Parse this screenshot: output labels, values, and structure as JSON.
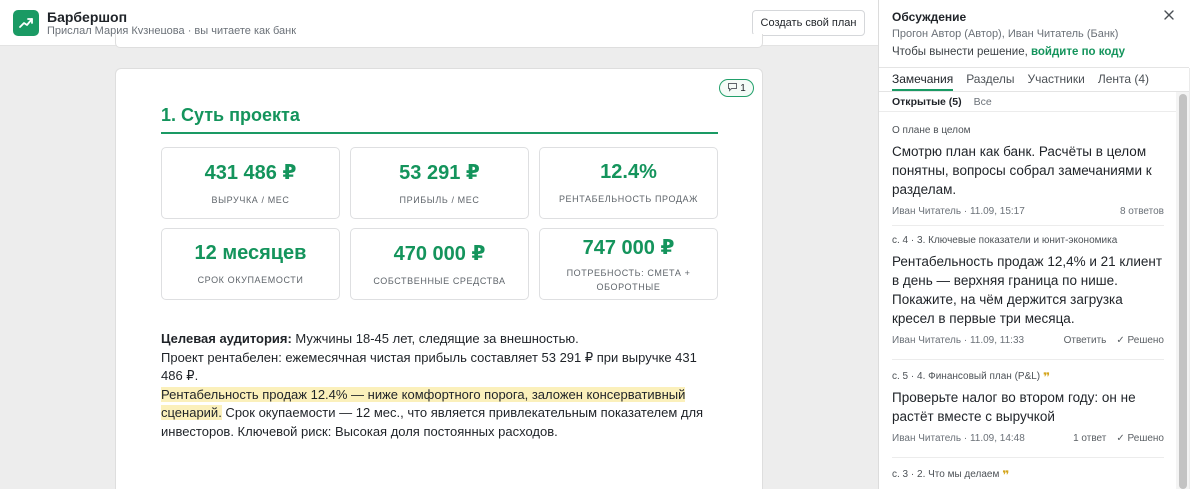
{
  "header": {
    "title": "Барбершоп",
    "subtitle": "Прислал Мария Кузнецова · вы читаете как банк",
    "create_button": "Создать свой план"
  },
  "document": {
    "comment_count": "1",
    "section_title": "1. Суть проекта",
    "metrics": [
      {
        "value": "431 486 ₽",
        "label": "ВЫРУЧКА / МЕС"
      },
      {
        "value": "53 291 ₽",
        "label": "ПРИБЫЛЬ / МЕС"
      },
      {
        "value": "12.4%",
        "label": "РЕНТАБЕЛЬНОСТЬ ПРОДАЖ"
      },
      {
        "value": "12 месяцев",
        "label": "СРОК ОКУПАЕМОСТИ"
      },
      {
        "value": "470 000 ₽",
        "label": "СОБСТВЕННЫЕ СРЕДСТВА"
      },
      {
        "value": "747 000 ₽",
        "label": "ПОТРЕБНОСТЬ: СМЕТА + ОБОРОТНЫЕ"
      }
    ],
    "audience_label": "Целевая аудитория:",
    "audience_text": " Мужчины 18-45 лет, следящие за внешностью.",
    "profit_text": "Проект рентабелен: ежемесячная чистая прибыль составляет 53 291 ₽ при выручке 431 486 ₽.",
    "highlight_text": "Рентабельность продаж 12.4% — ниже комфортного порога, заложен консервативный сценарий.",
    "rest_text": " Срок окупаемости — 12 мес., что является привлекательным показателем для инвесторов. Ключевой риск: Высокая доля постоянных расходов."
  },
  "discussion": {
    "title": "Обсуждение",
    "participants": "Прогон Автор (Автор), Иван Читатель (Банк)",
    "resolve_prefix": "Чтобы вынести решение, ",
    "resolve_link": "войдите по коду",
    "tabs": [
      "Замечания",
      "Разделы",
      "Участники",
      "Лента (4)"
    ],
    "filters": [
      "Открытые (5)",
      "Все"
    ],
    "comments": [
      {
        "location": "О плане в целом",
        "text": "Смотрю план как банк. Расчёты в целом понятны, вопросы собрал замечаниями к разделам.",
        "meta": "Иван Читатель · 11.09, 15:17",
        "replies": "8 ответов"
      },
      {
        "location": "с. 4 · 3. Ключевые показатели и юнит-экономика",
        "text": "Рентабельность продаж 12,4% и 21 клиент в день — верхняя граница по нише. Покажите, на чём держится загрузка кресел в первые три месяца.",
        "meta": "Иван Читатель · 11.09, 11:33",
        "reply_action": "Ответить",
        "resolve_action": "Решено"
      },
      {
        "location": "с. 5 · 4. Финансовый план (P&L)",
        "text": "Проверьте налог во втором году: он не растёт вместе с выручкой",
        "meta": "Иван Читатель · 11.09, 14:48",
        "replies": "1 ответ",
        "resolve_action": "Решено"
      },
      {
        "location": "с. 3 · 2. Что мы делаем"
      }
    ]
  },
  "colors": {
    "accent": "#1a9a64",
    "highlight": "#fbf0bb",
    "quote_icon": "#d4a51d"
  },
  "icons": [
    "trend-up-icon",
    "comment-icon",
    "close-icon",
    "check-icon",
    "quote-icon"
  ]
}
